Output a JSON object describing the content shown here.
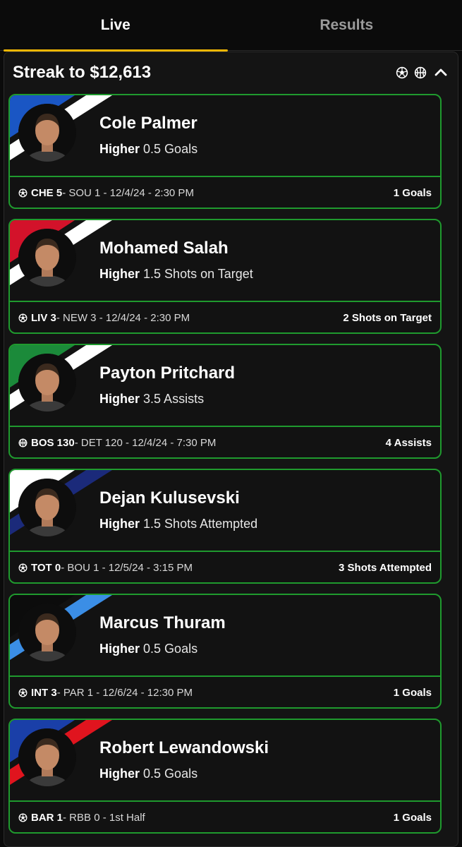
{
  "tabs": [
    {
      "label": "Live",
      "active": true
    },
    {
      "label": "Results",
      "active": false
    }
  ],
  "streak": {
    "title": "Streak to $12,613",
    "icons": [
      "soccer-ball-icon",
      "basketball-icon",
      "chevron-up-icon"
    ]
  },
  "colors": {
    "accent": "#f2b705",
    "card_border": "#1f9a2e",
    "background": "#0b0b0b",
    "panel": "#141414"
  },
  "picks": [
    {
      "player": "Cole Palmer",
      "direction": "Higher",
      "line": "0.5 Goals",
      "sport_icon": "soccer-ball-icon",
      "team": "CHE 5",
      "game_rest": " - SOU 1 - 12/4/24 - 2:30 PM",
      "result": "1 Goals",
      "stripe_colors": [
        "#1a56c4",
        "#ffffff"
      ]
    },
    {
      "player": "Mohamed Salah",
      "direction": "Higher",
      "line": "1.5 Shots on Target",
      "sport_icon": "soccer-ball-icon",
      "team": "LIV 3",
      "game_rest": " - NEW 3 - 12/4/24 - 2:30 PM",
      "result": "2 Shots on Target",
      "stripe_colors": [
        "#d3122a",
        "#ffffff"
      ]
    },
    {
      "player": "Payton Pritchard",
      "direction": "Higher",
      "line": "3.5 Assists",
      "sport_icon": "basketball-icon",
      "team": "BOS 130",
      "game_rest": " - DET 120 - 12/4/24 - 7:30 PM",
      "result": "4 Assists",
      "stripe_colors": [
        "#1b8a3a",
        "#ffffff"
      ]
    },
    {
      "player": "Dejan Kulusevski",
      "direction": "Higher",
      "line": "1.5 Shots Attempted",
      "sport_icon": "soccer-ball-icon",
      "team": "TOT 0",
      "game_rest": " - BOU 1 - 12/5/24 - 3:15 PM",
      "result": "3 Shots Attempted",
      "stripe_colors": [
        "#ffffff",
        "#1b2a7a"
      ]
    },
    {
      "player": "Marcus Thuram",
      "direction": "Higher",
      "line": "0.5 Goals",
      "sport_icon": "soccer-ball-icon",
      "team": "INT 3",
      "game_rest": " - PAR 1 - 12/6/24 - 12:30 PM",
      "result": "1 Goals",
      "stripe_colors": [
        "#0c0c0c",
        "#3b8ee6"
      ]
    },
    {
      "player": "Robert Lewandowski",
      "direction": "Higher",
      "line": "0.5 Goals",
      "sport_icon": "soccer-ball-icon",
      "team": "BAR 1",
      "game_rest": " - RBB 0 - 1st Half",
      "result": "1 Goals",
      "stripe_colors": [
        "#1a3fa8",
        "#e0141e"
      ]
    }
  ]
}
